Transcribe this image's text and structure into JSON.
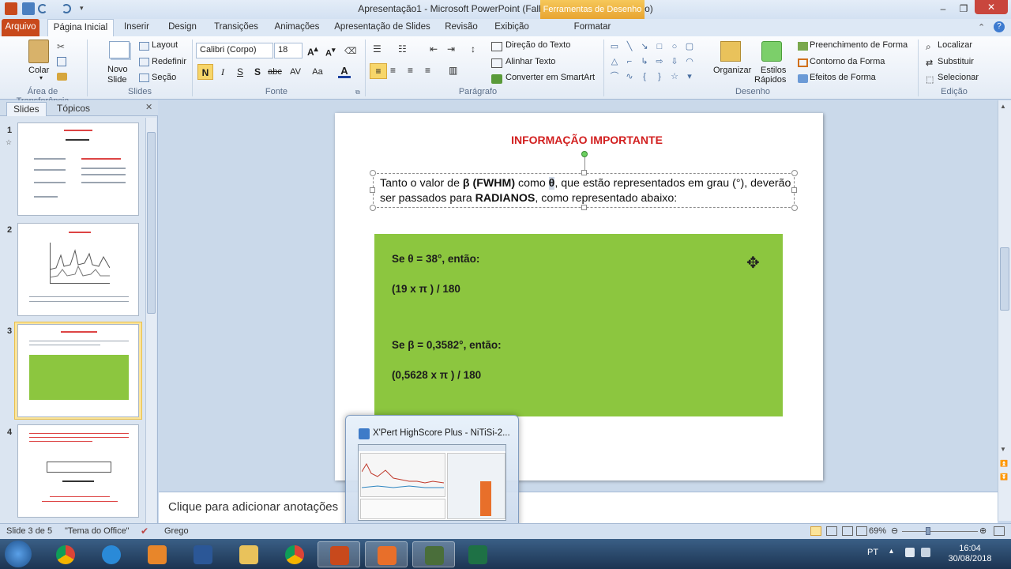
{
  "window": {
    "title": "Apresentação1  -  Microsoft PowerPoint (Falha na Ativação do Produto)",
    "context_tab": "Ferramentas de Desenho",
    "controls": {
      "minimize": "–",
      "restore": "❐",
      "close": "✕"
    }
  },
  "tabs": [
    "Arquivo",
    "Página Inicial",
    "Inserir",
    "Design",
    "Transições",
    "Animações",
    "Apresentação de Slides",
    "Revisão",
    "Exibição",
    "Formatar"
  ],
  "ribbon": {
    "groups": {
      "clipboard": "Área de Transferência",
      "slides": "Slides",
      "font": "Fonte",
      "paragraph": "Parágrafo",
      "drawing": "Desenho",
      "editing": "Edição"
    },
    "paste": "Colar",
    "new_slide": [
      "Novo",
      "Slide"
    ],
    "layout": "Layout",
    "reset": "Redefinir",
    "section": "Seção",
    "font_name": "Calibri (Corpo)",
    "font_size": "18",
    "bold": "N",
    "italic": "I",
    "underline": "S",
    "strikethrough": "S",
    "text_direction": "Direção do Texto",
    "align_text": "Alinhar Texto",
    "convert_smartart": "Converter em SmartArt",
    "arrange": "Organizar",
    "quick_styles": [
      "Estilos",
      "Rápidos"
    ],
    "shape_fill": "Preenchimento de Forma",
    "shape_outline": "Contorno da Forma",
    "shape_effects": "Efeitos de Forma",
    "find": "Localizar",
    "replace": "Substituir",
    "select": "Selecionar"
  },
  "pane": {
    "tab_slides": "Slides",
    "tab_outline": "Tópicos",
    "thumbs": [
      "1",
      "2",
      "3",
      "4"
    ]
  },
  "slide": {
    "title": "INFORMAÇÃO IMPORTANTE",
    "body_pre": "Tanto o valor de ",
    "body_beta": "β (FWHM)",
    "body_mid": " como ",
    "body_theta": "θ",
    "body_post": ", que estão representados em grau (°), deverão ser passados para ",
    "body_radianos": "RADIANOS",
    "body_end": ", como representado abaixo:",
    "green_lines": [
      "Se θ = 38°, então:",
      "(19 x π ) / 180",
      "Se β = 0,3582°, então:",
      "(0,5628 x π ) / 180"
    ]
  },
  "notes_placeholder": "Clique para adicionar anotações",
  "preview_title": "X'Pert HighScore Plus - NiTiSi-2...",
  "status": {
    "slide": "Slide 3 de 5",
    "theme": "\"Tema do Office\"",
    "language": "Grego",
    "zoom": "69%"
  },
  "tray": {
    "lang": "PT",
    "time": "16:04",
    "date": "30/08/2018"
  },
  "colors": {
    "accent_title": "#d21f1f",
    "green_box": "#8cc63f",
    "file_tab": "#c8491c",
    "context_tab": "#e8a431"
  }
}
